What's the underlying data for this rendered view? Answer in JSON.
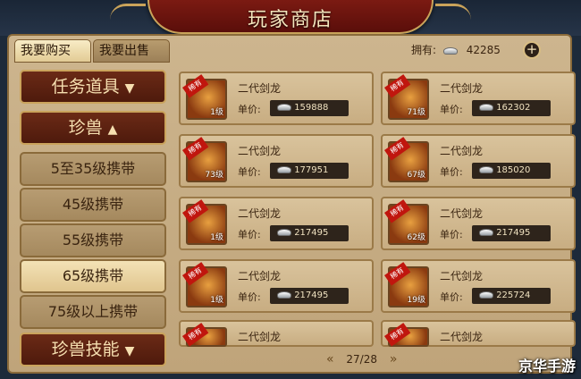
{
  "title": "玩家商店",
  "tabs": {
    "buy": "我要购买",
    "sell": "我要出售"
  },
  "currency": {
    "label": "拥有:",
    "value": "42285",
    "icon": "silver-ingot-icon"
  },
  "sidebar": {
    "items": [
      {
        "label": "任务道具",
        "type": "head",
        "arrow": "▼"
      },
      {
        "label": "珍兽",
        "type": "sel",
        "arrow": "▲"
      },
      {
        "label": "5至35级携带",
        "type": "normal"
      },
      {
        "label": "45级携带",
        "type": "normal"
      },
      {
        "label": "55级携带",
        "type": "normal"
      },
      {
        "label": "65级携带",
        "type": "sel"
      },
      {
        "label": "75级以上携带",
        "type": "normal"
      },
      {
        "label": "珍兽技能",
        "type": "head",
        "arrow": "▼"
      }
    ]
  },
  "ribbon": "稀有",
  "price_label": "单价:",
  "cards": [
    {
      "name": "二代剑龙",
      "level": "1级",
      "price": "159888"
    },
    {
      "name": "二代剑龙",
      "level": "71级",
      "price": "162302"
    },
    {
      "name": "二代剑龙",
      "level": "73级",
      "price": "177951"
    },
    {
      "name": "二代剑龙",
      "level": "67级",
      "price": "185020"
    },
    {
      "name": "二代剑龙",
      "level": "1级",
      "price": "217495"
    },
    {
      "name": "二代剑龙",
      "level": "62级",
      "price": "217495"
    },
    {
      "name": "二代剑龙",
      "level": "1级",
      "price": "217495"
    },
    {
      "name": "二代剑龙",
      "level": "19级",
      "price": "225724"
    },
    {
      "name": "二代剑龙",
      "level": "",
      "price": ""
    },
    {
      "name": "二代剑龙",
      "level": "",
      "price": ""
    }
  ],
  "pager": {
    "text": "27/28",
    "prev": "«",
    "next": "»"
  },
  "watermark": "京华手游",
  "colors": {
    "banner": "#6b1610",
    "panel": "#c8ad82",
    "price_box": "#2e241b",
    "ribbon": "#c0160e"
  }
}
